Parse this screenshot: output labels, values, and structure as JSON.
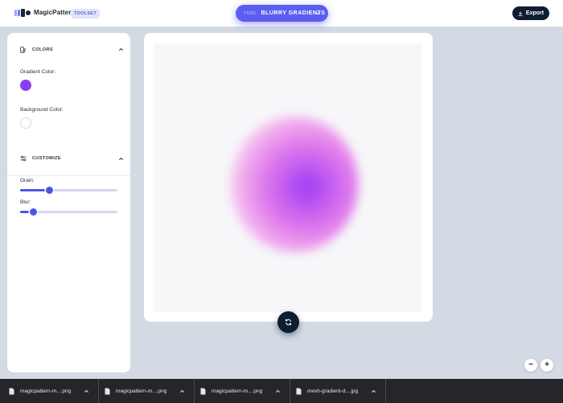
{
  "header": {
    "brand": "MagicPattern",
    "badge": "TOOLSET",
    "tool_prefix": "TOOL",
    "tool_name": "BLURRY GRADIENTS",
    "export_label": "Export"
  },
  "sidebar": {
    "colors_title": "COLORS",
    "gradient_color_label": "Gradient Color:",
    "gradient_color": "#8a3ff0",
    "background_color_label": "Background Color:",
    "background_color": "#ffffff",
    "customize_title": "CUSTOMIZE",
    "grain_label": "Grain:",
    "grain_value": 0.3,
    "blur_label": "Blur:",
    "blur_value": 0.14
  },
  "canvas": {
    "regenerate_icon": "refresh-icon"
  },
  "zoom": {
    "out_label": "−",
    "in_label": "+"
  },
  "downloads": [
    {
      "name": "magicpattern-m....png"
    },
    {
      "name": "magicpattern-m....png"
    },
    {
      "name": "magicpattern-m....png"
    },
    {
      "name": "mesh-gradient-d....jpg"
    }
  ],
  "colors": {
    "accent": "#5b5ef0",
    "dark": "#0f1d33",
    "slider": "#4f54e8"
  }
}
